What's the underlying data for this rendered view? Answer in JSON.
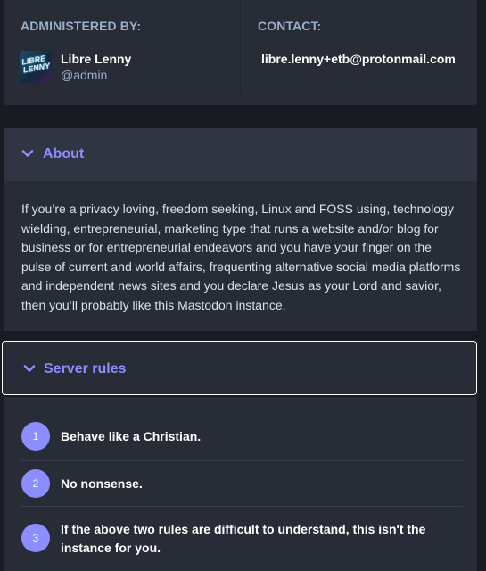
{
  "administered": {
    "label": "ADMINISTERED BY:",
    "avatar_text": "LIBRE LENNY",
    "display_name": "Libre Lenny",
    "handle": "@admin"
  },
  "contact": {
    "label": "CONTACT:",
    "email": "libre.lenny+etb@protonmail.com"
  },
  "about": {
    "title": "About",
    "body": "If you’re a privacy loving, freedom seeking, Linux and FOSS using, technology wielding, entrepreneurial, marketing type that runs a website and/or blog for business or for entrepreneurial endeavors and you have your finger on the pulse of current and world affairs, frequenting alternative social media platforms and independent news sites and you declare Jesus as your Lord and savior, then you’ll probably like this Mastodon instance."
  },
  "server_rules": {
    "title": "Server rules",
    "rules": [
      {
        "number": "1",
        "text": "Behave like a Christian."
      },
      {
        "number": "2",
        "text": "No nonsense."
      },
      {
        "number": "3",
        "text": "If the above two rules are difficult to understand, this isn't the instance for you."
      }
    ]
  },
  "colors": {
    "accent": "#8c8dff",
    "page_bg": "#191b22",
    "panel_bg": "#282c37",
    "header_bg": "#313543",
    "muted_text": "#9baec8"
  },
  "icons": {
    "section_toggle": "chevron-down-icon"
  }
}
